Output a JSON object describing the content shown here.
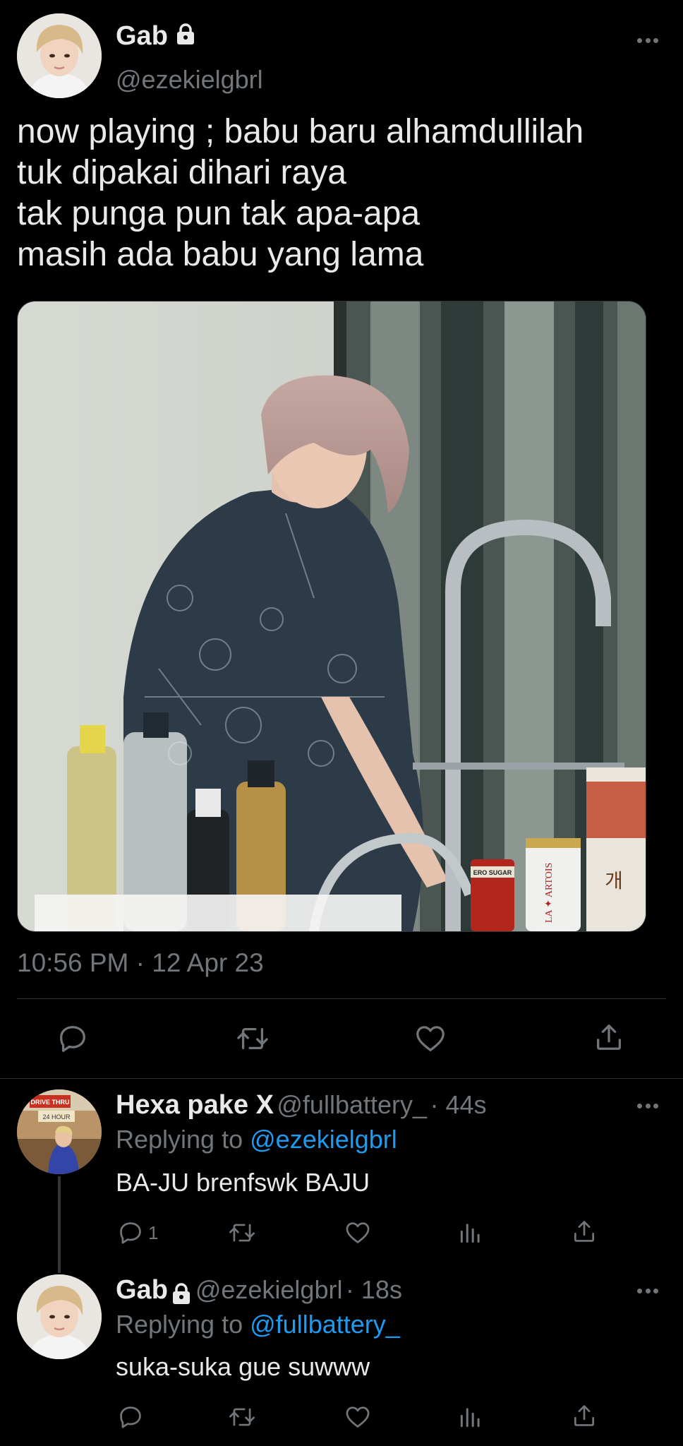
{
  "main_tweet": {
    "author_name": "Gab",
    "author_handle": "@ezekielgbrl",
    "text_lines": [
      "now playing ; babu baru alhamdullilah",
      "tuk dipakai dihari raya",
      "tak punga pun tak apa-apa",
      "masih ada babu yang lama"
    ],
    "timestamp": "10:56 PM · 12 Apr 23",
    "media_labels": {
      "can_label": "LA ✦ ARTOIS",
      "small_can_label": "ERO SUGAR",
      "pack_label": "개"
    }
  },
  "replies": [
    {
      "author_name": "Hexa pake X",
      "author_handle": "@fullbattery_",
      "time": "· 44s",
      "replying_prefix": "Replying to",
      "replying_to": "@ezekielgbrl",
      "text": "BA-JU brenfswk BAJU",
      "reply_count": "1",
      "avatar_sign_top": "DRIVE THRU",
      "avatar_sign_bottom": "24 HOUR"
    },
    {
      "author_name": "Gab",
      "author_handle": "@ezekielgbrl",
      "time": "· 18s",
      "replying_prefix": "Replying to",
      "replying_to": "@fullbattery_",
      "text": "suka-suka gue suwww",
      "reply_count": ""
    }
  ],
  "icons": {
    "reply": "reply-icon",
    "retweet": "retweet-icon",
    "like": "heart-icon",
    "views": "views-icon",
    "share": "share-icon",
    "more": "more-icon",
    "lock": "lock-icon"
  },
  "colors": {
    "background": "#000000",
    "text": "#e7e9ea",
    "secondary": "#71767b",
    "link": "#1d9bf0",
    "divider": "#2f3336"
  }
}
